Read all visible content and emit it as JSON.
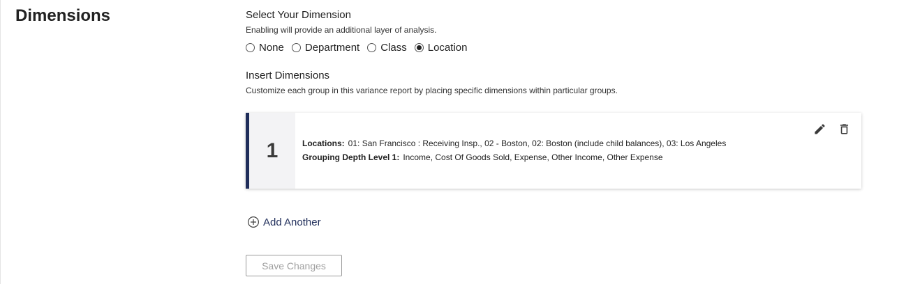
{
  "section": {
    "title": "Dimensions"
  },
  "select_dimension": {
    "heading": "Select Your Dimension",
    "helper": "Enabling will provide an additional layer of analysis.",
    "options": [
      {
        "label": "None",
        "selected": false
      },
      {
        "label": "Department",
        "selected": false
      },
      {
        "label": "Class",
        "selected": false
      },
      {
        "label": "Location",
        "selected": true
      }
    ]
  },
  "insert_dimensions": {
    "heading": "Insert Dimensions",
    "helper": "Customize each group in this variance report by placing specific dimensions within particular groups."
  },
  "groups": [
    {
      "number": "1",
      "locations_label": "Locations:",
      "locations_value": "01: San Francisco : Receiving Insp., 02 - Boston, 02: Boston (include child balances), 03: Los Angeles",
      "grouping_label": "Grouping Depth Level 1:",
      "grouping_value": "Income, Cost Of Goods Sold, Expense, Other Income, Other Expense"
    }
  ],
  "add_another_label": "Add Another",
  "save_label": "Save Changes",
  "colors": {
    "accent": "#1f2d5a",
    "number_bg": "#f3f3f5",
    "disabled_text": "#a0a0a0"
  },
  "icons": {
    "edit": "pencil-icon",
    "delete": "trash-icon",
    "add": "plus-circle-icon"
  }
}
